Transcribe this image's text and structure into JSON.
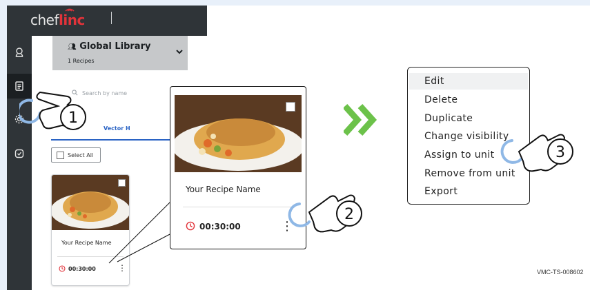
{
  "app": {
    "logo_prefix": "chef",
    "logo_suffix": "linc",
    "library_title": "Global Library",
    "library_count": "1 Recipes",
    "search_placeholder": "Search by name",
    "active_tab": "Vector H",
    "select_all": "Select All"
  },
  "recipe_card": {
    "name": "Your Recipe Name",
    "time": "00:30:00"
  },
  "context_menu": {
    "items": [
      "Edit",
      "Delete",
      "Duplicate",
      "Change visibility",
      "Assign to unit",
      "Remove from unit",
      "Export"
    ]
  },
  "steps": [
    "1",
    "2",
    "3"
  ],
  "doc_id": "VMC-TS-008602",
  "colors": {
    "rail_bg": "#2f3438",
    "accent_red": "#e2333a",
    "tab_blue": "#2a63c4",
    "arrow_green": "#6cc24a"
  },
  "icons": {
    "rail": [
      "location-pin-icon",
      "document-icon",
      "gear-icon",
      "shield-icon"
    ]
  }
}
